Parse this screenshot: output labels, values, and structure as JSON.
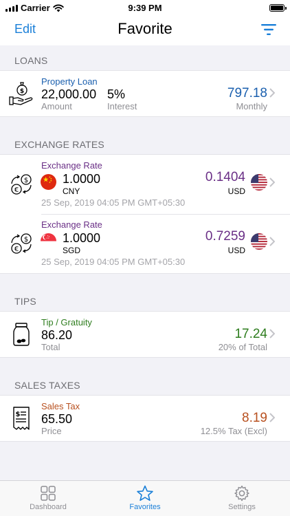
{
  "status_bar": {
    "carrier": "Carrier",
    "time": "9:39 PM"
  },
  "nav": {
    "edit_label": "Edit",
    "title": "Favorite",
    "filter_icon": "filter-icon"
  },
  "sections": {
    "loans": "LOANS",
    "exchange": "EXCHANGE RATES",
    "tips": "TIPS",
    "sales": "SALES TAXES"
  },
  "loan": {
    "title": "Property Loan",
    "amount": "22,000.00",
    "amount_label": "Amount",
    "interest": "5%",
    "interest_label": "Interest",
    "result": "797.18",
    "result_label": "Monthly",
    "title_color": "#1a5fae",
    "result_color": "#1a5fae"
  },
  "exchange_rates": [
    {
      "title": "Exchange Rate",
      "from_value": "1.0000",
      "from_code": "CNY",
      "from_flag": "china-flag",
      "date": "25 Sep, 2019 04:05 PM GMT+05:30",
      "to_value": "0.1404",
      "to_code": "USD",
      "to_flag": "us-flag"
    },
    {
      "title": "Exchange Rate",
      "from_value": "1.0000",
      "from_code": "SGD",
      "from_flag": "singapore-flag",
      "date": "25 Sep, 2019 04:05 PM GMT+05:30",
      "to_value": "0.7259",
      "to_code": "USD",
      "to_flag": "us-flag"
    }
  ],
  "exchange_color": "#6a2f86",
  "tip": {
    "title": "Tip / Gratuity",
    "amount": "86.20",
    "amount_label": "Total",
    "result": "17.24",
    "result_label": "20% of Total",
    "color": "#2e7d1e"
  },
  "sales_tax": {
    "title": "Sales Tax",
    "amount": "65.50",
    "amount_label": "Price",
    "result": "8.19",
    "result_label": "12.5% Tax (Excl)",
    "color": "#b8501f"
  },
  "tabs": [
    {
      "label": "Dashboard",
      "icon": "grid-icon",
      "active": false
    },
    {
      "label": "Favorites",
      "icon": "star-icon",
      "active": true
    },
    {
      "label": "Settings",
      "icon": "gear-icon",
      "active": false
    }
  ],
  "accent_color": "#1a7fd8"
}
